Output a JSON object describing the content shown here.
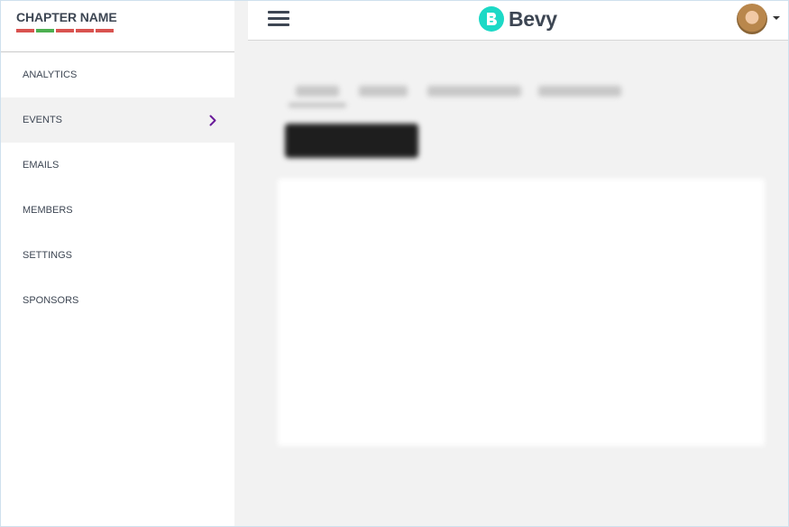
{
  "sidebar": {
    "chapter_name": "CHAPTER NAME",
    "stripe_colors": [
      "#d9534f",
      "#4caf50",
      "#d9534f",
      "#d9534f",
      "#d9534f"
    ],
    "items": [
      {
        "label": "ANALYTICS"
      },
      {
        "label": "EVENTS",
        "active": true
      },
      {
        "label": "EMAILS"
      },
      {
        "label": "MEMBERS"
      },
      {
        "label": "SETTINGS"
      },
      {
        "label": "SPONSORS"
      }
    ]
  },
  "header": {
    "brand_name": "Bevy",
    "brand_color": "#1cd9c6",
    "menu_icon": "hamburger-icon",
    "avatar_icon": "user-avatar"
  },
  "main": {
    "tabs": [
      "",
      "",
      "",
      ""
    ],
    "create_button_label": ""
  },
  "colors": {
    "accent": "#6a1b9a",
    "text": "#3d4653"
  }
}
